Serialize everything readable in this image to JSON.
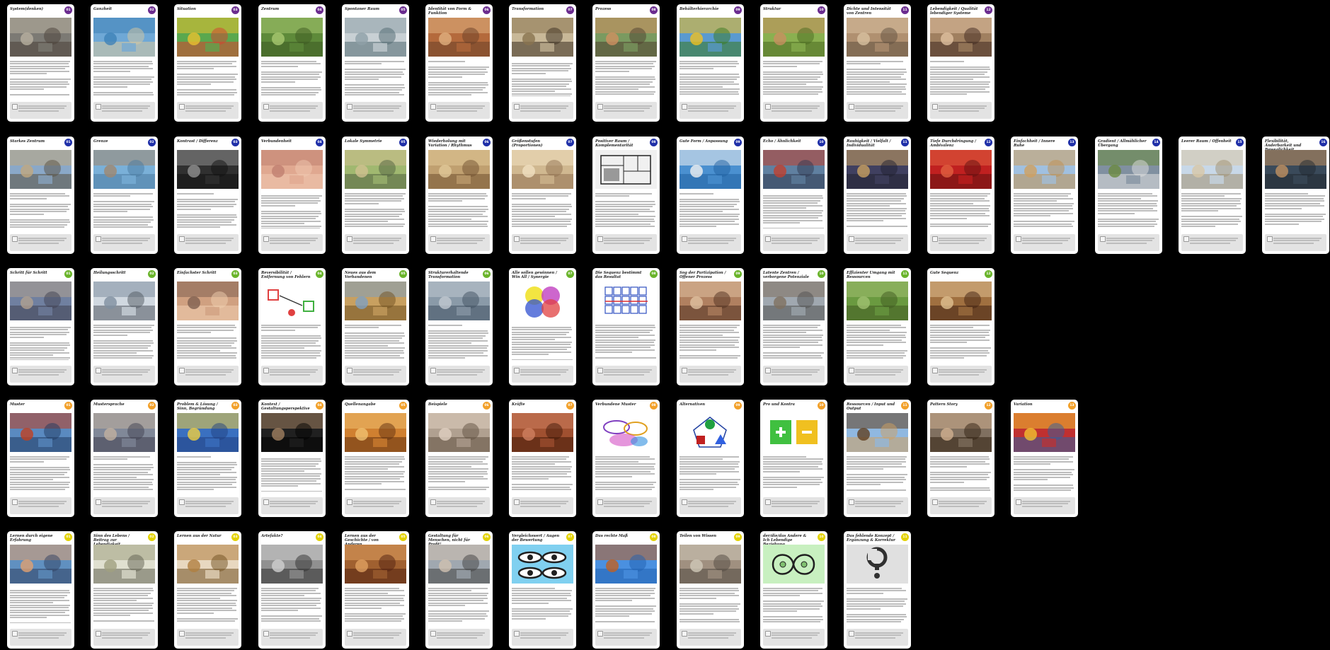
{
  "colors": {
    "purple": "#6b2c8f",
    "blue": "#1f2fa8",
    "green": "#6ab42b",
    "orange": "#f2a029",
    "yellow": "#e3d200"
  },
  "rows": [
    {
      "color": "purple",
      "cards": [
        {
          "title": "System(denken)",
          "num": "01",
          "photo": "street-crowd"
        },
        {
          "title": "Ganzheit",
          "num": "02",
          "photo": "coast-village"
        },
        {
          "title": "Situation",
          "num": "03",
          "photo": "playground"
        },
        {
          "title": "Zentrum",
          "num": "04",
          "photo": "garden-path"
        },
        {
          "title": "Spontaner Raum",
          "num": "05",
          "photo": "misty-lake"
        },
        {
          "title": "Identität von Form & Funktion",
          "num": "06",
          "photo": "market-crowd"
        },
        {
          "title": "Transformation",
          "num": "07",
          "photo": "insect"
        },
        {
          "title": "Prozess",
          "num": "08",
          "photo": "market-people"
        },
        {
          "title": "Behälterhierarchie",
          "num": "09",
          "photo": "sunflower"
        },
        {
          "title": "Struktur",
          "num": "10",
          "photo": "snail"
        },
        {
          "title": "Dichte und Intensität von Zentren",
          "num": "11",
          "photo": "town-square"
        },
        {
          "title": "Lebendigkeit / Qualität lebendiger Systeme",
          "num": "12",
          "photo": "festival-crowd"
        }
      ]
    },
    {
      "color": "blue",
      "cards": [
        {
          "title": "Starkes Zentrum",
          "num": "01",
          "photo": "cathedral"
        },
        {
          "title": "Grenze",
          "num": "02",
          "photo": "harbor-wall"
        },
        {
          "title": "Kontrast / Differenz",
          "num": "03",
          "photo": "dark-street"
        },
        {
          "title": "Verbundenheit",
          "num": "04",
          "photo": "hands"
        },
        {
          "title": "Lokale Symmetrie",
          "num": "05",
          "photo": "courtyard"
        },
        {
          "title": "Wiederholung mit Variation / Rhythmus",
          "num": "06",
          "photo": "arches"
        },
        {
          "title": "Größenstufen (Proportionen)",
          "num": "07",
          "photo": "vaults"
        },
        {
          "title": "Positiver Raum / Komplementarität",
          "num": "08",
          "photo": "floorplan"
        },
        {
          "title": "Gute Form / Anpassung",
          "num": "09",
          "photo": "sailboats"
        },
        {
          "title": "Echo / Ähnlichkeit",
          "num": "10",
          "photo": "houses-river"
        },
        {
          "title": "Rauhigkeit / Vielfalt / Individualität",
          "num": "11",
          "photo": "pottery"
        },
        {
          "title": "Tiefe Durchdringung / Ambivalenz",
          "num": "12",
          "photo": "red-gate"
        },
        {
          "title": "Einfachheit / Innere Ruhe",
          "num": "13",
          "photo": "pyramids"
        },
        {
          "title": "Gradient / Allmählicher Übergang",
          "num": "14",
          "photo": "rainbow"
        },
        {
          "title": "Leerer Raum / Offenheit",
          "num": "15",
          "photo": "mosque-court"
        },
        {
          "title": "Flexibilität, Änderbarkeit und Beweglichkeit",
          "num": "16",
          "photo": "violinist"
        }
      ]
    },
    {
      "color": "green",
      "cards": [
        {
          "title": "Schritt für Schritt",
          "num": "01",
          "photo": "steps-man"
        },
        {
          "title": "Heilungsschritt",
          "num": "02",
          "photo": "hospital"
        },
        {
          "title": "Einfachster Schritt",
          "num": "03",
          "photo": "handshake"
        },
        {
          "title": "Reversibilität / Entfernung von Fehlern",
          "num": "04",
          "photo": "diagram-arrows"
        },
        {
          "title": "Neues aus dem Vorhandenen",
          "num": "05",
          "photo": "reed-hut"
        },
        {
          "title": "Strukturerhaltende Transformation",
          "num": "06",
          "photo": "dome"
        },
        {
          "title": "Alle sollen gewinnen / Win All / Synergie",
          "num": "07",
          "photo": "plus-circles"
        },
        {
          "title": "Die Sequenz bestimmt das Resultat",
          "num": "08",
          "photo": "grid-diagram"
        },
        {
          "title": "Sog der Partizipation / Offener Prozess",
          "num": "09",
          "photo": "audience"
        },
        {
          "title": "Latente Zentren / verborgene Potenziale",
          "num": "10",
          "photo": "ruin-building"
        },
        {
          "title": "Effizienter Umgang mit Ressourcen",
          "num": "11",
          "photo": "terraces"
        },
        {
          "title": "Gute Sequenz",
          "num": "12",
          "photo": "chess"
        }
      ]
    },
    {
      "color": "orange",
      "cards": [
        {
          "title": "Muster",
          "num": "01",
          "photo": "golden-gate"
        },
        {
          "title": "Mustersprache",
          "num": "02",
          "photo": "workshop"
        },
        {
          "title": "Problem & Lösung / Sinn, Begründung",
          "num": "03",
          "photo": "sketch-blue"
        },
        {
          "title": "Kontext / Gestaltungsperspektive",
          "num": "04",
          "photo": "lecture-dark"
        },
        {
          "title": "Quellenangabe",
          "num": "05",
          "photo": "orange-interior"
        },
        {
          "title": "Beispiele",
          "num": "06",
          "photo": "plaza-people"
        },
        {
          "title": "Kräfte",
          "num": "07",
          "photo": "wrestlers"
        },
        {
          "title": "Verbundene Muster",
          "num": "08",
          "photo": "ellipses"
        },
        {
          "title": "Alternativen",
          "num": "09",
          "photo": "shapes-diagram"
        },
        {
          "title": "Pro und Kontra",
          "num": "10",
          "photo": "plus-minus"
        },
        {
          "title": "Ressourcen / Input und Output",
          "num": "11",
          "photo": "windmill"
        },
        {
          "title": "Pattern Story",
          "num": "12",
          "photo": "portrait-table"
        },
        {
          "title": "Variation",
          "num": "13",
          "photo": "mosaic"
        }
      ]
    },
    {
      "color": "yellow",
      "cards": [
        {
          "title": "Lernen durch eigene Erfahrung",
          "num": "01",
          "photo": "child-play"
        },
        {
          "title": "Sinn des Lebens / Beitrag zur Lebendigkeit",
          "num": "02",
          "photo": "insect-pale"
        },
        {
          "title": "Lernen aus der Natur",
          "num": "03",
          "photo": "dragonfly"
        },
        {
          "title": "Artefakte?",
          "num": "04",
          "photo": "typewriter"
        },
        {
          "title": "Lernen aus der Geschichte / von Anderen",
          "num": "05",
          "photo": "library"
        },
        {
          "title": "Gestaltung für Menschen, nicht für Profit!",
          "num": "06",
          "photo": "crowd-city"
        },
        {
          "title": "Vergleichswert / Augen der Bewertung",
          "num": "07",
          "photo": "eyes"
        },
        {
          "title": "Das rechte Maß",
          "num": "08",
          "photo": "statue-sky"
        },
        {
          "title": "Teilen von Wissen",
          "num": "09",
          "photo": "classroom"
        },
        {
          "title": "der/die/das Andere & Ich Lebendige Beziehung",
          "num": "10",
          "photo": "loop-diagram"
        },
        {
          "title": "Das fehlende Konzept / Ergänzung & Korrektur",
          "num": "11",
          "photo": "question-mark"
        }
      ]
    }
  ]
}
